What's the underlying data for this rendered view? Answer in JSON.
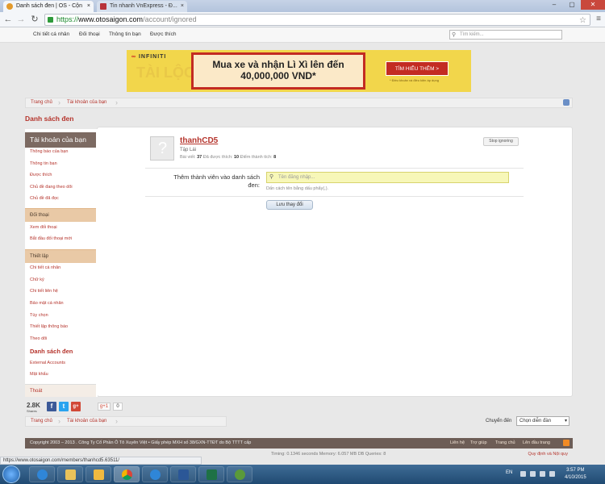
{
  "browser": {
    "tabs": [
      {
        "label": "Danh sách đen | OS - Cộn"
      },
      {
        "label": "Tin nhanh VnExpress - Đ..."
      }
    ],
    "url": {
      "scheme": "https://",
      "domain": "www.otosaigon.com",
      "path": "/account/ignored"
    },
    "status_url": "https://www.otosaigon.com/members/thanhcd5.63511/"
  },
  "sitenav": {
    "items": [
      "Chi tiết cá nhân",
      "Đối thoại",
      "Thông tin bạn",
      "Được thích"
    ],
    "search_placeholder": "Tìm kiếm..."
  },
  "banner": {
    "brand": "INFINITI",
    "bg_text": "TÀI LỘC",
    "line1": "Mua xe và nhận Lì Xì lên đến",
    "line2": "40,000,000 VND*",
    "cta": "TÌM HIỂU THÊM >",
    "note": "* Điều khoản và điều kiện áp dụng"
  },
  "breadcrumb": {
    "home": "Trang chủ",
    "account": "Tài khoản của bạn"
  },
  "page_title": "Danh sách đen",
  "sidebar": {
    "heading": "Tài khoản của bạn",
    "group1": [
      "Thông báo của bạn",
      "Thông tin bạn",
      "Được thích",
      "Chủ đề đang theo dõi",
      "Chủ đề đã đọc"
    ],
    "section_conversations": "Đối thoại",
    "group2": [
      "Xem đối thoại",
      "Bắt đầu đối thoại mới"
    ],
    "section_settings": "Thiết lập",
    "group3": [
      "Chi tiết cá nhân",
      "Chữ ký",
      "Chi tiết liên hệ",
      "Bảo mật cá nhân",
      "Tùy chọn",
      "Thiết lập thông báo",
      "Theo dõi"
    ],
    "active": "Danh sách đen",
    "group4": [
      "External Accounts",
      "Mật khẩu"
    ],
    "logout": "Thoát"
  },
  "ignored_user": {
    "name": "thanhCD5",
    "title": "Tập Lái",
    "stat_posts_label": "Bài viết:",
    "stat_posts": "37",
    "stat_likes_label": "Đã được thích:",
    "stat_likes": "10",
    "stat_points_label": "Điểm thành tích:",
    "stat_points": "8",
    "stop_button": "Stop ignoring"
  },
  "form": {
    "label": "Thêm thành viên vào danh sách đen:",
    "placeholder": "Tên đăng nhập...",
    "hint": "Dấn cách tên bằng dấu phẩy(,).",
    "save_button": "Lưu thay đổi"
  },
  "social": {
    "count": "2.8K",
    "count_label": "Shares",
    "fb": "f",
    "tw": "t",
    "gp": "g+",
    "gplus_label": "g+1",
    "gplus_count": "0"
  },
  "jump": {
    "label": "Chuyển đến",
    "value": "Chọn diễn đàn"
  },
  "footer": {
    "copyright": "Copyright 2003 – 2013 . Công Ty Cổ Phần Ô Tô Xuyên Việt • Giấy phép MXH số 38/GXN-TTĐT do Bộ TTTT cấp",
    "links": [
      "Liên hệ",
      "Trợ giúp",
      "Trang chủ",
      "Lên đầu trang"
    ],
    "stats": "Timing: 0.1346 seconds  Memory: 6.057 MB  DB Queries: 8",
    "terms": "Quy định và Nội quy"
  },
  "taskbar": {
    "lang": "EN",
    "time": "3:57 PM",
    "date": "4/10/2015"
  },
  "colors": {
    "accent": "#b5342c",
    "sidebar_head": "#7c6a62",
    "banner": "#f2d64b"
  }
}
